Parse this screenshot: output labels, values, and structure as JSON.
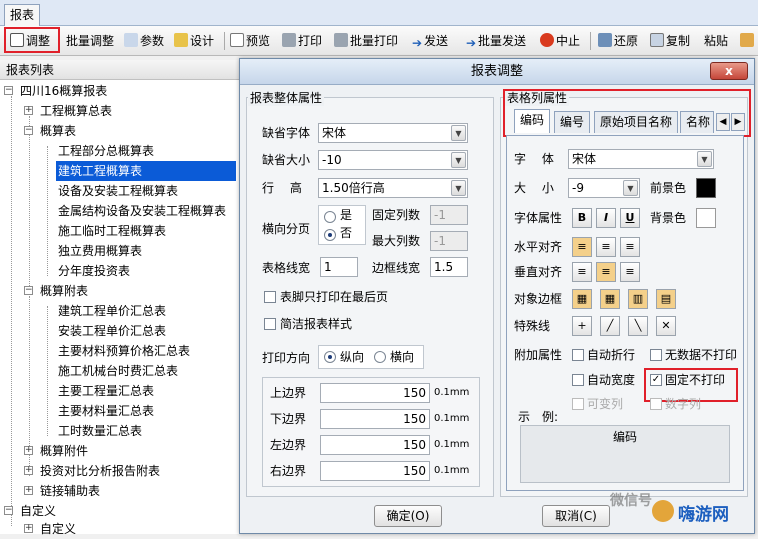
{
  "menu": {
    "report_tab": "报表"
  },
  "toolbar": {
    "adjust": "调整",
    "batch_adjust": "批量调整",
    "params": "参数",
    "design": "设计",
    "preview": "预览",
    "print": "打印",
    "batch_print": "批量打印",
    "send": "发送",
    "batch_send": "批量发送",
    "stop": "中止",
    "restore": "还原",
    "copy": "复制",
    "paste": "粘贴"
  },
  "tree": {
    "header": "报表列表",
    "items": [
      {
        "label": "四川16概算报表"
      },
      {
        "label": "工程概算总表"
      },
      {
        "label": "概算表"
      },
      {
        "label": "工程部分总概算表"
      },
      {
        "label": "建筑工程概算表"
      },
      {
        "label": "设备及安装工程概算表"
      },
      {
        "label": "金属结构设备及安装工程概算表"
      },
      {
        "label": "施工临时工程概算表"
      },
      {
        "label": "独立费用概算表"
      },
      {
        "label": "分年度投资表"
      },
      {
        "label": "概算附表"
      },
      {
        "label": "建筑工程单价汇总表"
      },
      {
        "label": "安装工程单价汇总表"
      },
      {
        "label": "主要材料预算价格汇总表"
      },
      {
        "label": "施工机械台时费汇总表"
      },
      {
        "label": "主要工程量汇总表"
      },
      {
        "label": "主要材料量汇总表"
      },
      {
        "label": "工时数量汇总表"
      },
      {
        "label": "概算附件"
      },
      {
        "label": "投资对比分析报告附表"
      },
      {
        "label": "链接辅助表"
      },
      {
        "label": "自定义"
      },
      {
        "label": "自定义"
      }
    ]
  },
  "dialog": {
    "title": "报表调整",
    "close": "x",
    "overall": {
      "group_title": "报表整体属性",
      "font_label": "缺省字体",
      "font_value": "宋体",
      "size_label": "缺省大小",
      "size_value": "-10",
      "line_height_label": "行　 高",
      "line_height_value": "1.50倍行高",
      "paging_label": "横向分页",
      "paging_yes": "是",
      "paging_no": "否",
      "fixed_cols_label": "固定列数",
      "fixed_cols_value": "-1",
      "max_cols_label": "最大列数",
      "max_cols_value": "-1",
      "grid_width_label": "表格线宽",
      "grid_width_value": "1",
      "border_width_label": "边框线宽",
      "border_width_value": "1.5",
      "footer_last_page": "表脚只打印在最后页",
      "simple_style": "简洁报表样式",
      "direction_label": "打印方向",
      "direction_portrait": "纵向",
      "direction_landscape": "横向",
      "margins": [
        {
          "label": "上边界",
          "value": "150",
          "unit": "0.1mm"
        },
        {
          "label": "下边界",
          "value": "150",
          "unit": "0.1mm"
        },
        {
          "label": "左边界",
          "value": "150",
          "unit": "0.1mm"
        },
        {
          "label": "右边界",
          "value": "150",
          "unit": "0.1mm"
        }
      ]
    },
    "column": {
      "group_title": "表格列属性",
      "tabs": [
        "编码",
        "编号",
        "原始项目名称",
        "名称"
      ],
      "font_label": "字　 体",
      "font_value": "宋体",
      "size_label": "大　 小",
      "size_value": "-9",
      "fg_label": "前景色",
      "fg_color": "#000000",
      "attr_label": "字体属性",
      "bold": "B",
      "italic": "I",
      "underline": "U",
      "bg_label": "背景色",
      "bg_color": "#ffffff",
      "halign_label": "水平对齐",
      "valign_label": "垂直对齐",
      "border_label": "对象边框",
      "special_line_label": "特殊线",
      "extra_label": "附加属性",
      "auto_wrap": "自动折行",
      "no_data_no_print": "无数据不打印",
      "auto_width": "自动宽度",
      "fixed_no_print": "固定不打印",
      "variable_col": "可变列",
      "numeric_col": "数字列",
      "example_label": "示　例:",
      "example_value": "编码"
    },
    "ok": "确定(O)",
    "cancel": "取消(C)"
  },
  "watermark": {
    "wechat": "微信号",
    "site": "嗨游网"
  },
  "colors": {
    "highlight_red": "#e0202a",
    "selection_blue": "#0b5bd7"
  }
}
